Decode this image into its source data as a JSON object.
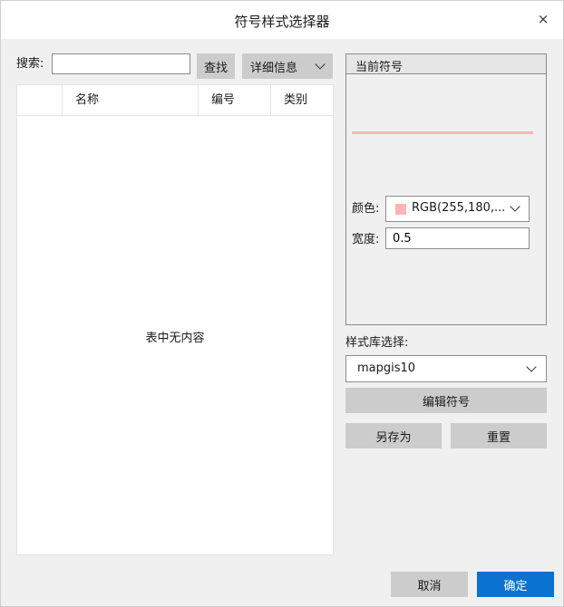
{
  "window": {
    "title": "符号样式选择器",
    "close_glyph": "×"
  },
  "search": {
    "label": "搜索:",
    "value": "",
    "find_label": "查找",
    "detail_label": "详细信息"
  },
  "table": {
    "columns": [
      "",
      "名称",
      "编号",
      "类别"
    ],
    "empty_text": "表中无内容"
  },
  "current": {
    "title": "当前符号",
    "preview_color": "#FFB4B4",
    "color_label": "颜色:",
    "color_value": "RGB(255,180,...",
    "color_swatch": "#FFB4B4",
    "width_label": "宽度:",
    "width_value": "0.5"
  },
  "library": {
    "label": "样式库选择:",
    "value": "mapgis10"
  },
  "buttons": {
    "edit_symbol": "编辑符号",
    "save_as": "另存为",
    "reset": "重置",
    "cancel": "取消",
    "ok": "确定"
  },
  "colors": {
    "accent": "#0A72D1",
    "button_gray": "#CCCCCC",
    "background": "#F0F0F0"
  }
}
